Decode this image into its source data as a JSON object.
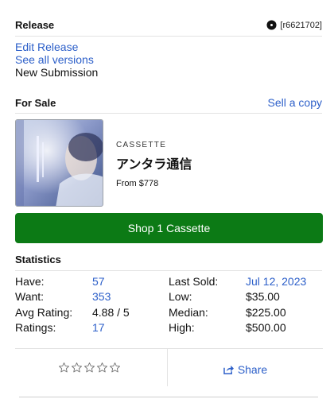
{
  "release": {
    "title": "Release",
    "id": "[r6621702]",
    "links": {
      "edit": "Edit Release",
      "versions": "See all versions"
    },
    "submission": "New Submission"
  },
  "for_sale": {
    "title": "For Sale",
    "sell_link": "Sell a copy",
    "item": {
      "format": "CASSETTE",
      "title": "アンタラ通信",
      "price": "From $778"
    },
    "shop_button": "Shop 1 Cassette"
  },
  "statistics": {
    "title": "Statistics",
    "rows": [
      {
        "label": "Have:",
        "value": "57",
        "label2": "Last Sold:",
        "value2": "Jul 12, 2023"
      },
      {
        "label": "Want:",
        "value": "353",
        "label2": "Low:",
        "value2": "$35.00"
      },
      {
        "label": "Avg Rating:",
        "value": "4.88 / 5",
        "label2": "Median:",
        "value2": "$225.00"
      },
      {
        "label": "Ratings:",
        "value": "17",
        "label2": "High:",
        "value2": "$500.00"
      }
    ]
  },
  "actions": {
    "rating_stars": 5,
    "rating_value": 0,
    "share_label": "Share"
  },
  "colors": {
    "link": "#2c5fc9",
    "shop_button": "#0c7a15"
  },
  "icons": [
    "disc-icon",
    "star-outline-icon",
    "share-icon"
  ]
}
